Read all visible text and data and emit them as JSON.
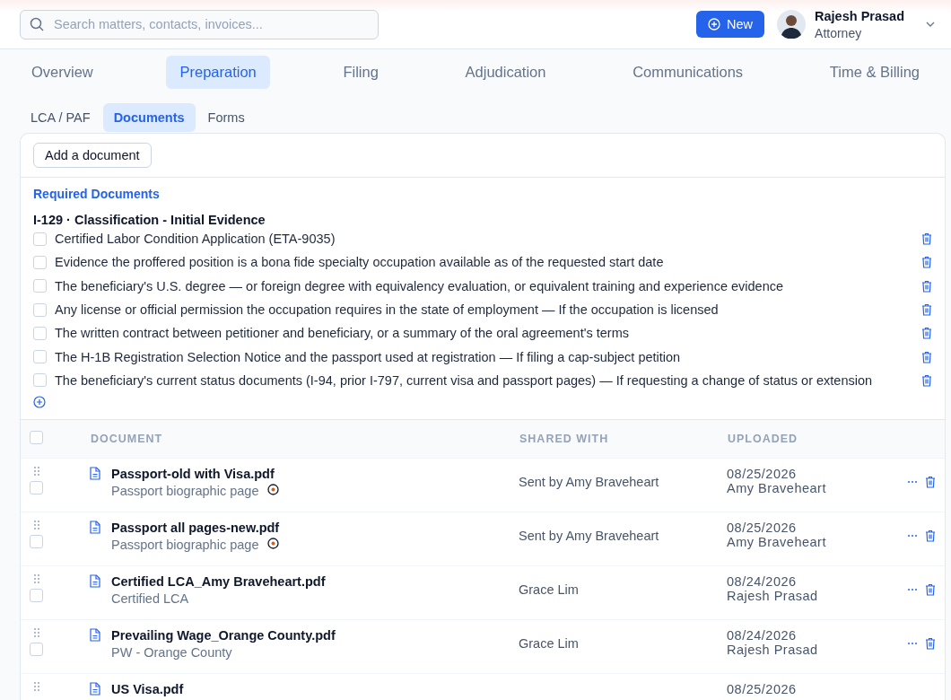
{
  "search": {
    "placeholder": "Search matters, contacts, invoices..."
  },
  "new_button": "New",
  "user": {
    "name": "Rajesh Prasad",
    "role": "Attorney"
  },
  "tabs": [
    {
      "label": "Overview",
      "selected": false
    },
    {
      "label": "Preparation",
      "selected": true
    },
    {
      "label": "Filing",
      "selected": false
    },
    {
      "label": "Adjudication",
      "selected": false
    },
    {
      "label": "Communications",
      "selected": false
    },
    {
      "label": "Time & Billing",
      "selected": false
    }
  ],
  "subtabs": [
    {
      "label": "LCA / PAF",
      "selected": false
    },
    {
      "label": "Documents",
      "selected": true
    },
    {
      "label": "Forms",
      "selected": false
    }
  ],
  "add_button": "Add a document",
  "required": {
    "heading": "Required Documents",
    "group": "I-129 · Classification - Initial Evidence",
    "items": [
      {
        "label": "Certified Labor Condition Application (ETA-9035)",
        "checked": false
      },
      {
        "label": "Evidence the proffered position is a bona fide specialty occupation available as of the requested start date",
        "checked": false
      },
      {
        "label": "The beneficiary's U.S. degree — or foreign degree with equivalency evaluation, or equivalent training and experience evidence",
        "checked": false
      },
      {
        "label": "Any license or official permission the occupation requires in the state of employment — If the occupation is licensed",
        "checked": false
      },
      {
        "label": "The written contract between petitioner and beneficiary, or a summary of the oral agreement's terms",
        "checked": false
      },
      {
        "label": "The H-1B Registration Selection Notice and the passport used at registration — If filing a cap-subject petition",
        "checked": false
      },
      {
        "label": "The beneficiary's current status documents (I-94, prior I-797, current visa and passport pages) — If requesting a change of status or extension",
        "checked": false
      }
    ]
  },
  "table": {
    "columns": [
      "DOCUMENT",
      "SHARED WITH",
      "UPLOADED"
    ],
    "all_checked": false,
    "rows": [
      {
        "name": "Passport-old with Visa.pdf",
        "description": "Passport biographic page",
        "flagged": true,
        "shared_with": "Sent by Amy Braveheart",
        "date": "08/25/2026",
        "uploader": "Amy Braveheart",
        "checked": false
      },
      {
        "name": "Passport all pages-new.pdf",
        "description": "Passport biographic page",
        "flagged": true,
        "shared_with": "Sent by Amy Braveheart",
        "date": "08/25/2026",
        "uploader": "Amy Braveheart",
        "checked": false
      },
      {
        "name": "Certified LCA_Amy Braveheart.pdf",
        "description": "Certified LCA",
        "flagged": false,
        "shared_with": "Grace Lim",
        "date": "08/24/2026",
        "uploader": "Rajesh Prasad",
        "checked": false
      },
      {
        "name": "Prevailing Wage_Orange County.pdf",
        "description": "PW - Orange County",
        "flagged": false,
        "shared_with": "Grace Lim",
        "date": "08/24/2026",
        "uploader": "Rajesh Prasad",
        "checked": false
      },
      {
        "name": "US Visa.pdf",
        "date": "08/25/2026"
      }
    ]
  }
}
